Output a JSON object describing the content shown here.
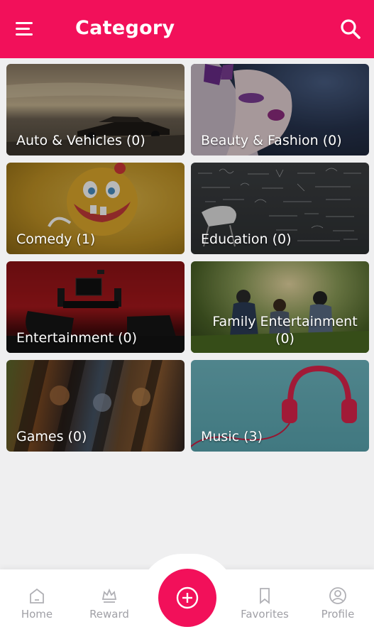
{
  "header": {
    "title": "Category",
    "menu_icon": "hamburger-menu-icon",
    "search_icon": "search-icon"
  },
  "categories": [
    {
      "label": "Auto & Vehicles (0)",
      "image": "car-on-road-sunset"
    },
    {
      "label": "Beauty & Fashion (0)",
      "image": "woman-purple-makeup"
    },
    {
      "label": "Comedy (1)",
      "image": "funny-cartoon-face"
    },
    {
      "label": "Education (0)",
      "image": "chalkboard-formulas"
    },
    {
      "label": "Entertainment (0)",
      "image": "home-theater-room"
    },
    {
      "label": "Family Entertainment (0)",
      "image": "family-in-park"
    },
    {
      "label": "Games (0)",
      "image": "game-characters-collage"
    },
    {
      "label": "Music (3)",
      "image": "red-headphones"
    }
  ],
  "bottom_nav": {
    "home": "Home",
    "reward": "Reward",
    "add_icon": "plus-circle-icon",
    "favorites": "Favorites",
    "profile": "Profile"
  },
  "colors": {
    "accent": "#f2105a",
    "background": "#efeff0",
    "nav_text": "#a0a0a6"
  }
}
